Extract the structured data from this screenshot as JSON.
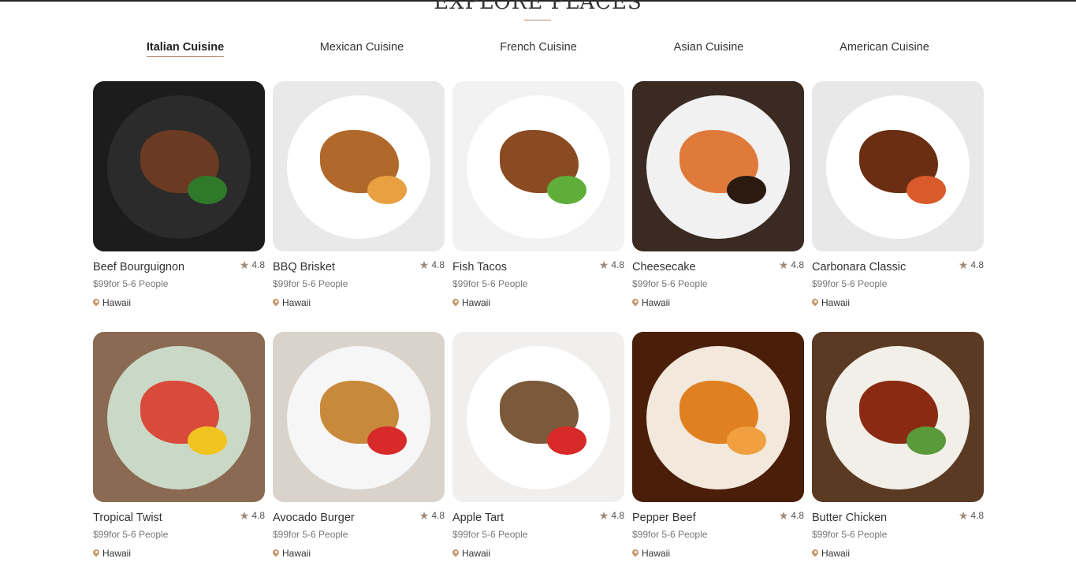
{
  "section": {
    "title": "EXPLORE PLACES"
  },
  "tabs": [
    {
      "label": "Italian Cuisine",
      "active": true
    },
    {
      "label": "Mexican Cuisine",
      "active": false
    },
    {
      "label": "French Cuisine",
      "active": false
    },
    {
      "label": "Asian Cuisine",
      "active": false
    },
    {
      "label": "American Cuisine",
      "active": false
    }
  ],
  "cards": [
    {
      "title": "Beef Bourguignon",
      "rating": "4.8",
      "price": "$99for 5-6 People",
      "location": "Hawaii",
      "bg": "#1c1c1c",
      "plate": "#2b2b2b",
      "food": "#6b3a22",
      "accent": "#2f7a2a"
    },
    {
      "title": "BBQ Brisket",
      "rating": "4.8",
      "price": "$99for 5-6 People",
      "location": "Hawaii",
      "bg": "#e9e9e9",
      "plate": "#ffffff",
      "food": "#b0692b",
      "accent": "#e8a040"
    },
    {
      "title": "Fish Tacos",
      "rating": "4.8",
      "price": "$99for 5-6 People",
      "location": "Hawaii",
      "bg": "#f2f2f2",
      "plate": "#ffffff",
      "food": "#8a4a22",
      "accent": "#5fae3a"
    },
    {
      "title": "Cheesecake",
      "rating": "4.8",
      "price": "$99for 5-6 People",
      "location": "Hawaii",
      "bg": "#3a2a22",
      "plate": "#f1f1f1",
      "food": "#e07a3a",
      "accent": "#2a1a10"
    },
    {
      "title": "Carbonara Classic",
      "rating": "4.8",
      "price": "$99for 5-6 People",
      "location": "Hawaii",
      "bg": "#e8e8e8",
      "plate": "#ffffff",
      "food": "#6a2e12",
      "accent": "#d95a2a"
    },
    {
      "title": "Tropical Twist",
      "rating": "4.8",
      "price": "$99for 5-6 People",
      "location": "Hawaii",
      "bg": "#8a6a52",
      "plate": "#c9d9c6",
      "food": "#d94a3a",
      "accent": "#f2c420"
    },
    {
      "title": "Avocado Burger",
      "rating": "4.8",
      "price": "$99for 5-6 People",
      "location": "Hawaii",
      "bg": "#d9d3cc",
      "plate": "#f6f6f6",
      "food": "#c9893a",
      "accent": "#d92a2a"
    },
    {
      "title": "Apple Tart",
      "rating": "4.8",
      "price": "$99for 5-6 People",
      "location": "Hawaii",
      "bg": "#f0efed",
      "plate": "#ffffff",
      "food": "#7a5a3a",
      "accent": "#d92a2a"
    },
    {
      "title": "Pepper Beef",
      "rating": "4.8",
      "price": "$99for 5-6 People",
      "location": "Hawaii",
      "bg": "#4a1e08",
      "plate": "#f2e8dc",
      "food": "#e08020",
      "accent": "#f0a040"
    },
    {
      "title": "Butter Chicken",
      "rating": "4.8",
      "price": "$99for 5-6 People",
      "location": "Hawaii",
      "bg": "#5a3a22",
      "plate": "#f2efe8",
      "food": "#8a2a12",
      "accent": "#5a9a3a"
    }
  ],
  "colors": {
    "accent": "#b38b6d",
    "star": "#a08a7a",
    "pin": "#c59a6d"
  },
  "icons": {
    "rating": "star-icon",
    "location": "map-pin-icon"
  }
}
